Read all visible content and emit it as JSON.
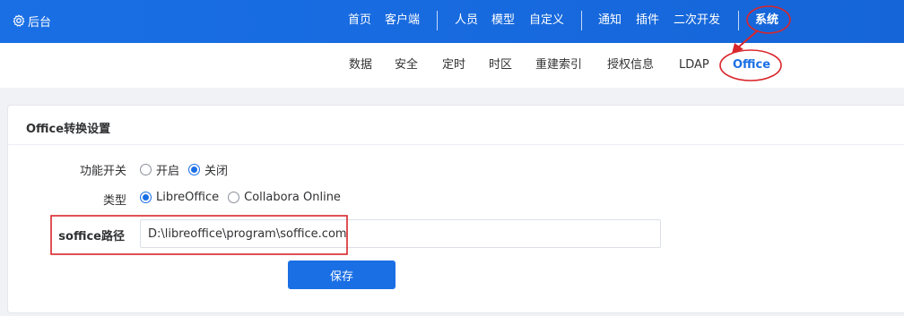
{
  "header": {
    "brand_label": "后台",
    "nav": [
      {
        "label": "首页"
      },
      {
        "label": "客户端"
      },
      {
        "label": "人员"
      },
      {
        "label": "模型"
      },
      {
        "label": "自定义"
      },
      {
        "label": "通知"
      },
      {
        "label": "插件"
      },
      {
        "label": "二次开发"
      },
      {
        "label": "系统",
        "active": true
      }
    ]
  },
  "subnav": {
    "items": [
      {
        "label": "数据"
      },
      {
        "label": "安全"
      },
      {
        "label": "定时"
      },
      {
        "label": "时区"
      },
      {
        "label": "重建索引"
      },
      {
        "label": "授权信息"
      },
      {
        "label": "LDAP"
      },
      {
        "label": "Office",
        "active": true
      }
    ]
  },
  "card": {
    "title": "Office转换设置",
    "switch": {
      "label": "功能开关",
      "options": [
        {
          "label": "开启",
          "checked": false
        },
        {
          "label": "关闭",
          "checked": true
        }
      ]
    },
    "type": {
      "label": "类型",
      "options": [
        {
          "label": "LibreOffice",
          "checked": true
        },
        {
          "label": "Collabora Online",
          "checked": false
        }
      ]
    },
    "path": {
      "label": "soffice路径",
      "value": "D:\\libreoffice\\program\\soffice.com"
    },
    "save_label": "保存"
  },
  "colors": {
    "primary": "#1a6fe5",
    "annotation": "#d9262b"
  }
}
